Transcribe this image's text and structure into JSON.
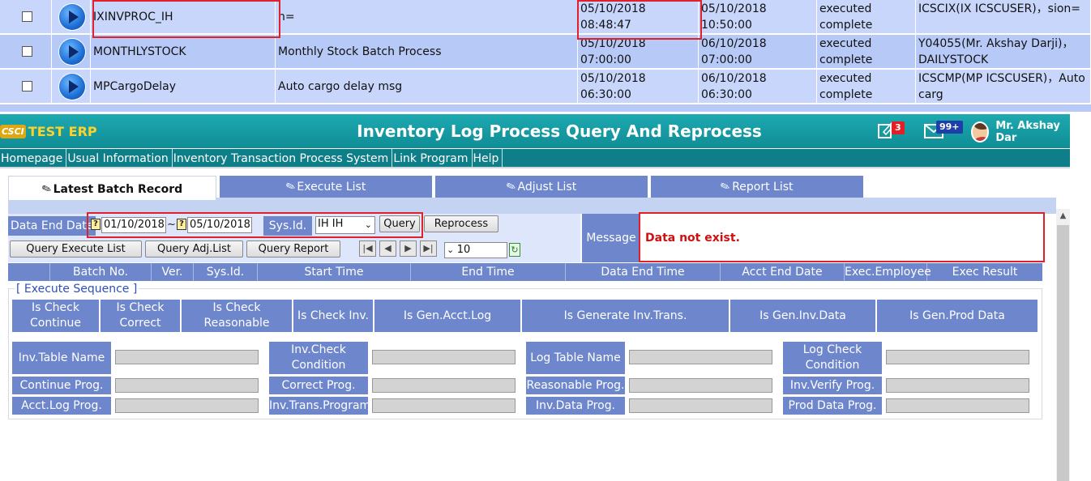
{
  "top_grid": {
    "rows": [
      {
        "name": "IXINVPROC_IH",
        "desc": "n=",
        "start": "05/10/2018 08:48:47",
        "end": "05/10/2018 10:50:00",
        "result": "executed complete",
        "message": "ICSCIX(IX ICSCUSER)，sion="
      },
      {
        "name": "MONTHLYSTOCK",
        "desc": "Monthly Stock Batch Process",
        "start": "05/10/2018 07:00:00",
        "end": "06/10/2018 07:00:00",
        "result": "executed complete",
        "message": "Y04055(Mr. Akshay Darji)，DAILYSTOCK"
      },
      {
        "name": "MPCargoDelay",
        "desc": "Auto cargo delay msg",
        "start": "05/10/2018 06:30:00",
        "end": "06/10/2018 06:30:00",
        "result": "executed complete",
        "message": "ICSCMP(MP ICSCUSER)，Auto carg"
      }
    ]
  },
  "header": {
    "logo_mark": "CSCI",
    "logo_text": "TEST ERP",
    "title": "Inventory Log Process Query And Reprocess",
    "notif_count": "3",
    "mail_count": "99+",
    "user": "Mr. Akshay Dar"
  },
  "menu": [
    "Homepage",
    "Usual Information",
    "Inventory Transaction Process System",
    "Link Program",
    "Help"
  ],
  "tabs": [
    "Latest Batch Record",
    "Execute List",
    "Adjust List",
    "Report List"
  ],
  "query": {
    "data_end_date_label": "Data End Date",
    "date_from": "01/10/2018",
    "tilde": "~",
    "date_to": "05/10/2018",
    "sysid_label": "Sys.Id.",
    "sysid_value": "IH IH",
    "query_btn": "Query",
    "reprocess_btn": "Reprocess",
    "query_exec_btn": "Query Execute List",
    "query_adj_btn": "Query Adj.List",
    "query_report_btn": "Query Report",
    "page_size": "10",
    "message_label": "Message",
    "message": "Data not exist."
  },
  "columns": [
    "",
    "Batch No.",
    "Ver.",
    "Sys.Id.",
    "Start Time",
    "End Time",
    "Data End Time",
    "Acct End Date",
    "Exec.Employee",
    "Exec Result"
  ],
  "execute": {
    "legend": "[ Execute Sequence ]",
    "headers": [
      "Is Check Continue",
      "Is Check Correct",
      "Is Check Reasonable",
      "Is Check Inv.",
      "Is Gen.Acct.Log",
      "Is Generate Inv.Trans.",
      "Is Gen.Inv.Data",
      "Is Gen.Prod Data"
    ],
    "fields": {
      "inv_table": "Inv.Table Name",
      "inv_check": "Inv.Check Condition",
      "log_table": "Log Table Name",
      "log_check": "Log Check Condition",
      "continue_prog": "Continue Prog.",
      "correct_prog": "Correct Prog.",
      "reasonable_prog": "Reasonable Prog.",
      "inv_verify_prog": "Inv.Verify Prog.",
      "acct_log_prog": "Acct.Log Prog.",
      "inv_trans_prog": "Inv.Trans.Program",
      "inv_data_prog": "Inv.Data Prog.",
      "prod_data_prog": "Prod Data Prog."
    }
  },
  "colors": {
    "header_teal": "#1ea9b0",
    "menu_teal": "#0e7f88",
    "label_blue": "#6d86cc",
    "grid_row": "#c8d6fb",
    "highlight_red": "#e0202a"
  }
}
